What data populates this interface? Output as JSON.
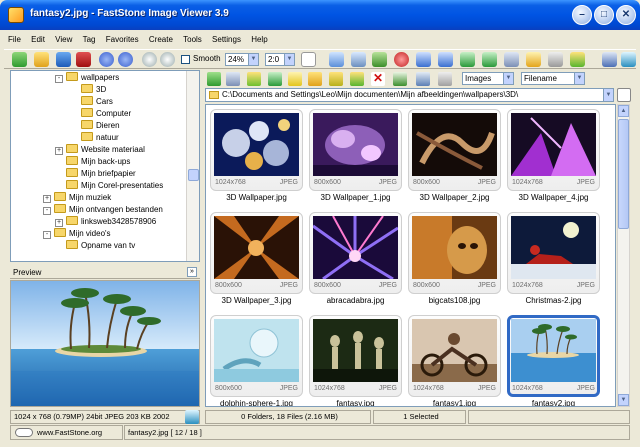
{
  "window": {
    "title": "fantasy2.jpg  -  FastStone Image Viewer 3.9",
    "minimize": "–",
    "maximize": "□",
    "close": "✕"
  },
  "menu": [
    "File",
    "Edit",
    "View",
    "Tag",
    "Favorites",
    "Create",
    "Tools",
    "Settings",
    "Help"
  ],
  "toolbar": {
    "smooth_label": "Smooth",
    "smooth_checked": false,
    "zoom_value": "24%",
    "ratio_value": "2:0"
  },
  "tree": [
    {
      "label": "wallpapers",
      "expander": "-"
    },
    {
      "label": "3D",
      "expander": ""
    },
    {
      "label": "Cars",
      "expander": ""
    },
    {
      "label": "Computer",
      "expander": ""
    },
    {
      "label": "Dieren",
      "expander": ""
    },
    {
      "label": "natuur",
      "expander": ""
    },
    {
      "label": "Website materiaal",
      "expander": "+"
    },
    {
      "label": "Mijn back-ups",
      "expander": ""
    },
    {
      "label": "Mijn briefpapier",
      "expander": ""
    },
    {
      "label": "Mijn Corel-presentaties",
      "expander": ""
    },
    {
      "label": "Mijn muziek",
      "expander": "+"
    },
    {
      "label": "Mijn ontvangen bestanden",
      "expander": "-"
    },
    {
      "label": "linksweb3428578906",
      "expander": "+"
    },
    {
      "label": "Mijn video's",
      "expander": "-"
    },
    {
      "label": "Opname van tv",
      "expander": ""
    }
  ],
  "preview": {
    "heading": "Preview",
    "info": "1024 x 768 (0.79MP)   24bit JPEG   203 KB   2002"
  },
  "filter": {
    "type_value": "Images",
    "sort_value": "Filename"
  },
  "path": "C:\\Documents and Settings\\Leo\\Mijn documenten\\Mijn afbeeldingen\\wallpapers\\3D\\",
  "thumbnails": [
    {
      "name": "3D Wallpaper.jpg",
      "dims": "1024x768",
      "format": "JPEG",
      "selected": false
    },
    {
      "name": "3D Wallpaper_1.jpg",
      "dims": "800x600",
      "format": "JPEG",
      "selected": false
    },
    {
      "name": "3D Wallpaper_2.jpg",
      "dims": "800x600",
      "format": "JPEG",
      "selected": false
    },
    {
      "name": "3D Wallpaper_4.jpg",
      "dims": "1024x768",
      "format": "JPEG",
      "selected": false
    },
    {
      "name": "3D Wallpaper_3.jpg",
      "dims": "800x600",
      "format": "JPEG",
      "selected": false
    },
    {
      "name": "abracadabra.jpg",
      "dims": "800x600",
      "format": "JPEG",
      "selected": false
    },
    {
      "name": "bigcats108.jpg",
      "dims": "800x600",
      "format": "JPEG",
      "selected": false
    },
    {
      "name": "Christmas-2.jpg",
      "dims": "1024x768",
      "format": "JPEG",
      "selected": false
    },
    {
      "name": "dolphin-sphere-1.jpg",
      "dims": "800x600",
      "format": "JPEG",
      "selected": false
    },
    {
      "name": "fantasy.jpg",
      "dims": "1024x768",
      "format": "JPEG",
      "selected": false
    },
    {
      "name": "fantasy1.jpg",
      "dims": "1024x768",
      "format": "JPEG",
      "selected": false
    },
    {
      "name": "fantasy2.jpg",
      "dims": "1024x768",
      "format": "JPEG",
      "selected": true
    }
  ],
  "status": {
    "folders_files": "0 Folders, 18 Files (2.16 MB)",
    "selected": "1 Selected",
    "website": "www.FastStone.org",
    "current": "fantasy2.jpg [ 12 / 18 ]"
  }
}
